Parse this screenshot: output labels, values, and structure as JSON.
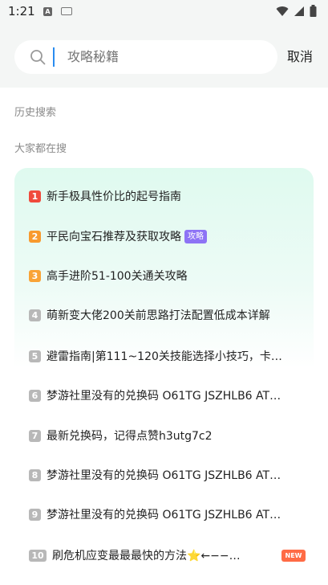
{
  "status_bar": {
    "time": "1:21",
    "note_badge": "A"
  },
  "search": {
    "placeholder": "攻略秘籍",
    "cancel_label": "取消"
  },
  "sections": {
    "history_label": "历史搜索",
    "trending_label": "大家都在搜"
  },
  "colors": {
    "rank_top1": "#f04a3c",
    "rank_top2": "#f89a2e",
    "rank_top3": "#f9a336",
    "rank_other": "#b8b8b8",
    "guide_tag": "#8d73f5",
    "new_tag": "#ff6b45",
    "caret": "#2a8cf0"
  },
  "hot_list": [
    {
      "rank": "1",
      "text": "新手极具性价比的起号指南"
    },
    {
      "rank": "2",
      "text": "平民向宝石推荐及获取攻略",
      "tag": "攻略"
    },
    {
      "rank": "3",
      "text": "高手进阶51-100关通关攻略"
    },
    {
      "rank": "4",
      "text": "萌新变大佬200关前思路打法配置低成本详解"
    },
    {
      "rank": "5",
      "text": "避雷指南|第111~120关技能选择小技巧，卡…"
    },
    {
      "rank": "6",
      "text": "梦游社里没有的兑换码 O61TG JSZHLB6 AT…"
    },
    {
      "rank": "7",
      "text": "最新兑换码，记得点赞h3utg7c2"
    },
    {
      "rank": "8",
      "text": "梦游社里没有的兑换码 O61TG JSZHLB6 AT…"
    },
    {
      "rank": "9",
      "text": "梦游社里没有的兑换码 O61TG JSZHLB6 AT…"
    },
    {
      "rank": "10",
      "text": "刷危机应变最最最快的方法⭐←−−…",
      "tag": "NEW"
    }
  ]
}
